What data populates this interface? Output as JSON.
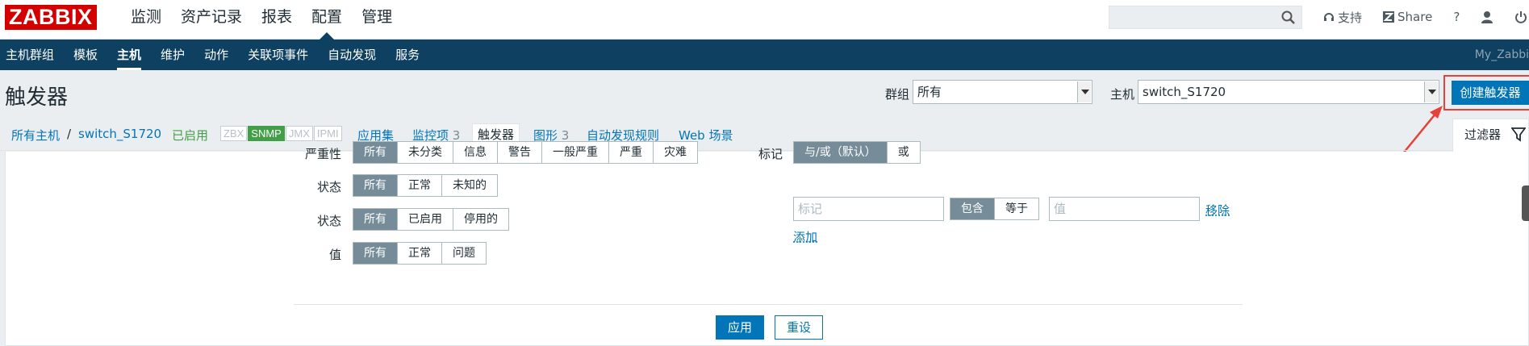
{
  "header": {
    "logo": "ZABBIX",
    "nav": [
      "监测",
      "资产记录",
      "报表",
      "配置",
      "管理"
    ],
    "active_nav": "配置",
    "support": "支持",
    "share": "Share",
    "help": "?"
  },
  "subnav": {
    "items": [
      "主机群组",
      "模板",
      "主机",
      "维护",
      "动作",
      "关联项事件",
      "自动发现",
      "服务"
    ],
    "active": "主机",
    "user": "My_Zabbi"
  },
  "page": {
    "title": "触发器",
    "group_label": "群组",
    "group_value": "所有",
    "host_label": "主机",
    "host_value": "switch_S1720",
    "create_button": "创建触发器"
  },
  "breadcrumb": {
    "all_hosts": "所有主机",
    "sep": "/",
    "host": "switch_S1720",
    "status": "已启用",
    "availability": [
      "ZBX",
      "SNMP",
      "JMX",
      "IPMI"
    ],
    "tabs": [
      {
        "label": "应用集",
        "count": ""
      },
      {
        "label": "监控项",
        "count": "3"
      },
      {
        "label": "触发器",
        "count": ""
      },
      {
        "label": "图形",
        "count": "3"
      },
      {
        "label": "自动发现规则",
        "count": ""
      },
      {
        "label": "Web 场景",
        "count": ""
      }
    ],
    "filter_tab": "过滤器"
  },
  "filter": {
    "severity_label": "严重性",
    "severity": [
      "所有",
      "未分类",
      "信息",
      "警告",
      "一般严重",
      "严重",
      "灾难"
    ],
    "state_label": "状态",
    "state": [
      "所有",
      "正常",
      "未知的"
    ],
    "status_label": "状态",
    "status": [
      "所有",
      "已启用",
      "停用的"
    ],
    "value_label": "值",
    "value": [
      "所有",
      "正常",
      "问题"
    ],
    "tags_label": "标记",
    "tags_mode": [
      "与/或（默认）",
      "或"
    ],
    "tag_placeholder": "标记",
    "tag_op": [
      "包含",
      "等于"
    ],
    "tag_value_placeholder": "值",
    "remove": "移除",
    "add": "添加",
    "apply": "应用",
    "reset": "重设"
  }
}
